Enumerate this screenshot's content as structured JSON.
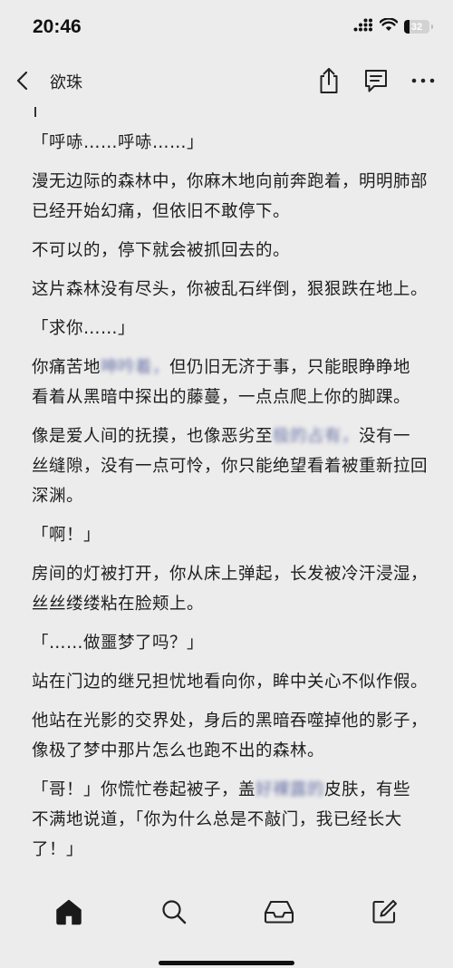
{
  "status_bar": {
    "time": "20:46",
    "battery": "32",
    "icons": [
      "signal-icon",
      "wifi-icon",
      "battery-icon"
    ]
  },
  "header": {
    "title": "欲珠",
    "icons": [
      "back-chevron-icon",
      "share-icon",
      "comment-icon",
      "more-icon"
    ]
  },
  "content": {
    "paragraphs": [
      {
        "text": "「呼哧……呼哧……」"
      },
      {
        "text": "漫无边际的森林中，你麻木地向前奔跑着，明明肺部已经开始幻痛，但依旧不敢停下。"
      },
      {
        "text": "不可以的，停下就会被抓回去的。"
      },
      {
        "text": "这片森林没有尽头，你被乱石绊倒，狠狠跌在地上。"
      },
      {
        "text": "「求你……」"
      },
      {
        "before": "你痛苦地",
        "blurred": "呻吟着，",
        "after": "但仍旧无济于事，只能眼睁睁地看着从黑暗中探出的藤蔓，一点点爬上你的脚踝。"
      },
      {
        "before": "像是爱人间的抚摸，也像恶劣至",
        "blurred": "极的占有，",
        "after": "没有一丝缝隙，没有一点可怜，你只能绝望看着被重新拉回深渊。"
      },
      {
        "text": "「啊！」"
      },
      {
        "text": "房间的灯被打开，你从床上弹起，长发被冷汗浸湿，丝丝缕缕粘在脸颊上。"
      },
      {
        "text": "「……做噩梦了吗？」"
      },
      {
        "text": "站在门边的继兄担忧地看向你，眸中关心不似作假。"
      },
      {
        "text": "他站在光影的交界处，身后的黑暗吞噬掉他的影子，像极了梦中那片怎么也跑不出的森林。"
      },
      {
        "before": "「哥！」你慌忙卷起被子，盖",
        "blurred": "好裸露的",
        "after": "皮肤，有些不满地说道，「你为什么总是不敲门，我已经长大了！」"
      }
    ]
  },
  "tab_bar": {
    "tabs": [
      "home-icon",
      "search-icon",
      "inbox-icon",
      "edit-icon"
    ]
  }
}
